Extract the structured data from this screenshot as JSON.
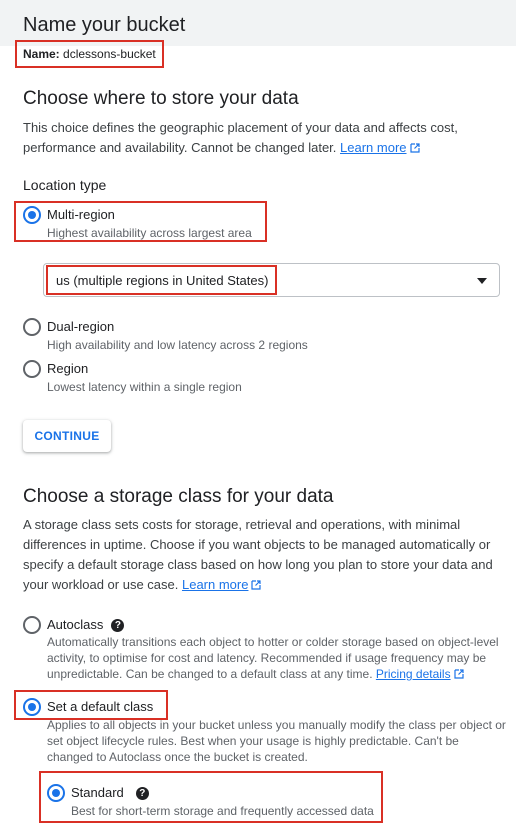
{
  "name_section": {
    "title": "Name your bucket",
    "name_label": "Name:",
    "name_value": "dclessons-bucket"
  },
  "location": {
    "title": "Choose where to store your data",
    "description": "This choice defines the geographic placement of your data and affects cost, performance and availability. Cannot be changed later.",
    "learn_more": "Learn more",
    "type_label": "Location type",
    "options": [
      {
        "label": "Multi-region",
        "desc": "Highest availability across largest area",
        "selected": true
      },
      {
        "label": "Dual-region",
        "desc": "High availability and low latency across 2 regions",
        "selected": false
      },
      {
        "label": "Region",
        "desc": "Lowest latency within a single region",
        "selected": false
      }
    ],
    "select_value": "us (multiple regions in United States)",
    "continue_label": "CONTINUE"
  },
  "storage": {
    "title": "Choose a storage class for your data",
    "description": "A storage class sets costs for storage, retrieval and operations, with minimal differences in uptime. Choose if you want objects to be managed automatically or specify a default storage class based on how long you plan to store your data and your workload or use case.",
    "learn_more": "Learn more",
    "autoclass": {
      "label": "Autoclass",
      "desc": "Automatically transitions each object to hotter or colder storage based on object-level activity, to optimise for cost and latency. Recommended if usage frequency may be unpredictable. Can be changed to a default class at any time.",
      "link": "Pricing details",
      "selected": false
    },
    "default_class": {
      "label": "Set a default class",
      "desc": "Applies to all objects in your bucket unless you manually modify the class per object or set object lifecycle rules. Best when your usage is highly predictable. Can't be changed to Autoclass once the bucket is created.",
      "selected": true
    },
    "standard": {
      "label": "Standard",
      "desc": "Best for short-term storage and frequently accessed data",
      "selected": true
    }
  },
  "colors": {
    "accent": "#1a73e8",
    "highlight": "#d93025",
    "header_bg": "#f1f3f4"
  }
}
